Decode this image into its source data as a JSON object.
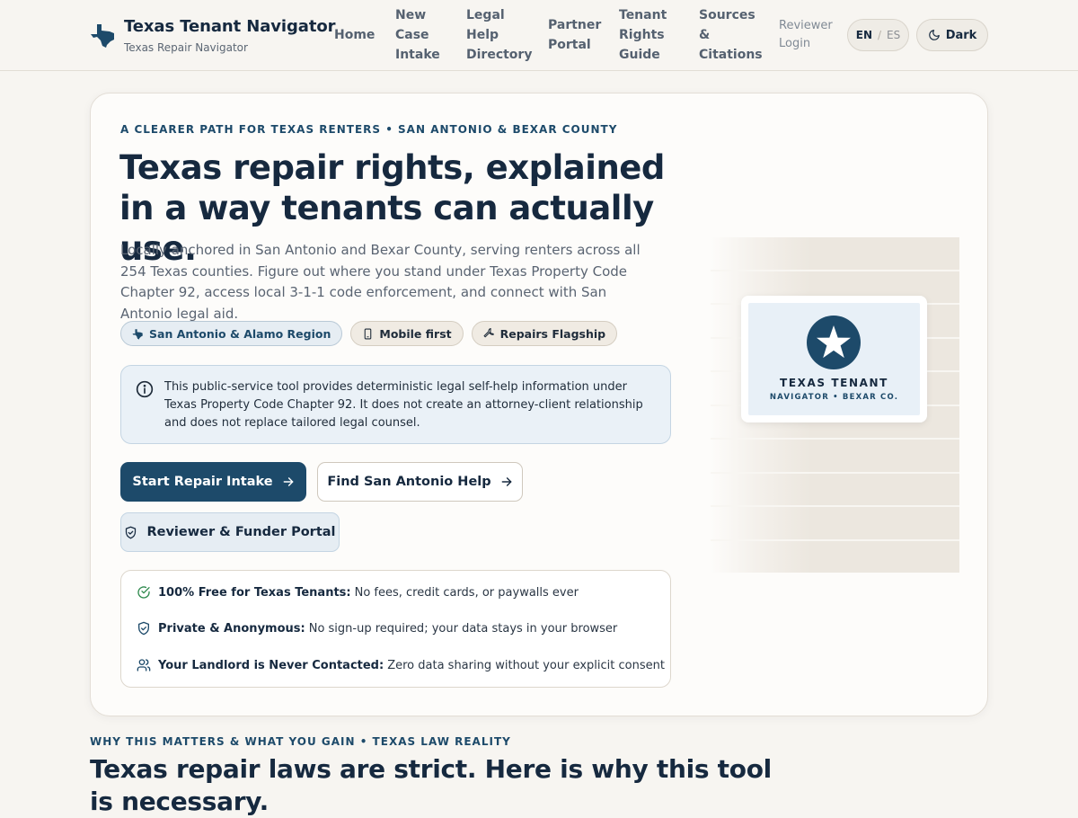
{
  "brand": {
    "title": "Texas Tenant Navigator",
    "subtitle": "Texas Repair Navigator",
    "logo_icon": "texas-state-icon"
  },
  "nav": {
    "items": [
      {
        "label": "Home"
      },
      {
        "label_lines": [
          "New",
          "Case",
          "Intake"
        ]
      },
      {
        "label_lines": [
          "Legal",
          "Help",
          "Directory"
        ]
      },
      {
        "label_lines": [
          "Partner",
          "Portal"
        ]
      },
      {
        "label_lines": [
          "Tenant",
          "Rights",
          "Guide"
        ]
      },
      {
        "label_lines": [
          "Sources",
          "&",
          "Citations"
        ]
      },
      {
        "label_lines": [
          "Reviewer",
          "Login"
        ]
      }
    ],
    "lang": {
      "en": "EN",
      "sep": "/",
      "es": "ES"
    },
    "dark_label": "Dark"
  },
  "hero": {
    "eyebrow": "A CLEARER PATH FOR TEXAS RENTERS • SAN ANTONIO & BEXAR COUNTY",
    "title": "Texas repair rights, explained in a way tenants can actually use.",
    "description": "Locally anchored in San Antonio and Bexar County, serving renters across all 254 Texas counties. Figure out where you stand under Texas Property Code Chapter 92, access local 3-1-1 code enforcement, and connect with San Antonio legal aid.",
    "chips": [
      {
        "label": "San Antonio & Alamo Region",
        "icon": "texas-state-icon"
      },
      {
        "label": "Mobile first",
        "icon": "phone-icon"
      },
      {
        "label": "Repairs Flagship",
        "icon": "wrench-icon"
      }
    ],
    "notice": "This public-service tool provides deterministic legal self-help information under Texas Property Code Chapter 92. It does not create an attorney-client relationship and does not replace tailored legal counsel.",
    "buttons": {
      "start": "Start Repair Intake",
      "find": "Find San Antonio Help",
      "portal": "Reviewer & Funder Portal"
    },
    "features": [
      {
        "bold": "100% Free for Texas Tenants:",
        "text": "No fees, credit cards, or paywalls ever",
        "icon": "check-circle-icon"
      },
      {
        "bold": "Private & Anonymous:",
        "text": "No sign-up required; your data stays in your browser",
        "icon": "shield-check-icon"
      },
      {
        "bold": "Your Landlord is Never Contacted:",
        "text": "Zero data sharing without your explicit consent",
        "icon": "users-icon"
      }
    ],
    "badge": {
      "title": "TEXAS TENANT",
      "subtitle": "NAVIGATOR • BEXAR CO."
    }
  },
  "section": {
    "eyebrow": "WHY THIS MATTERS & WHAT YOU GAIN • TEXAS LAW REALITY",
    "title": "Texas repair laws are strict. Here is why this tool is necessary."
  },
  "colors": {
    "primary": "#1d4a6a",
    "ink": "#16293f",
    "background": "#f7f5f1",
    "notice_bg": "#eaf1f7",
    "success": "#2f8a4e"
  }
}
